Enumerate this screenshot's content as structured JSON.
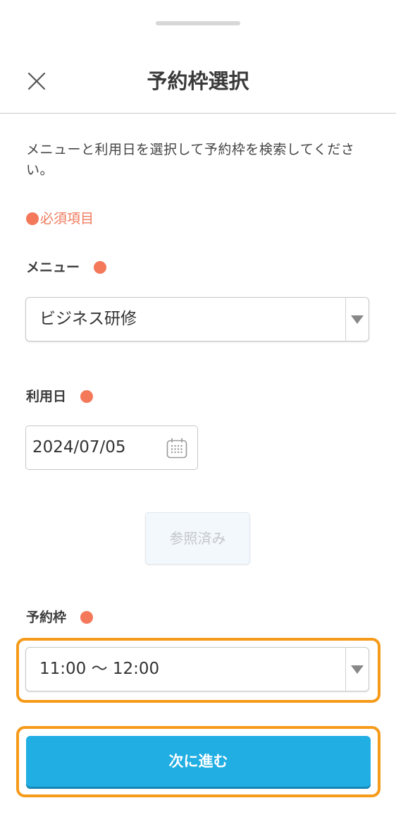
{
  "header": {
    "title": "予約枠選択"
  },
  "description": "メニューと利用日を選択して予約枠を検索してください。",
  "required_note": "必須項目",
  "menu": {
    "label": "メニュー",
    "value": "ビジネス研修"
  },
  "date": {
    "label": "利用日",
    "value": "2024/07/05"
  },
  "reference_button": {
    "label": "参照済み"
  },
  "slot": {
    "label": "予約枠",
    "value": "11:00 〜 12:00"
  },
  "next_button": {
    "label": "次に進む"
  },
  "colors": {
    "required": "#f4785a",
    "primary": "#20aee3",
    "highlight": "#f69a1a"
  }
}
